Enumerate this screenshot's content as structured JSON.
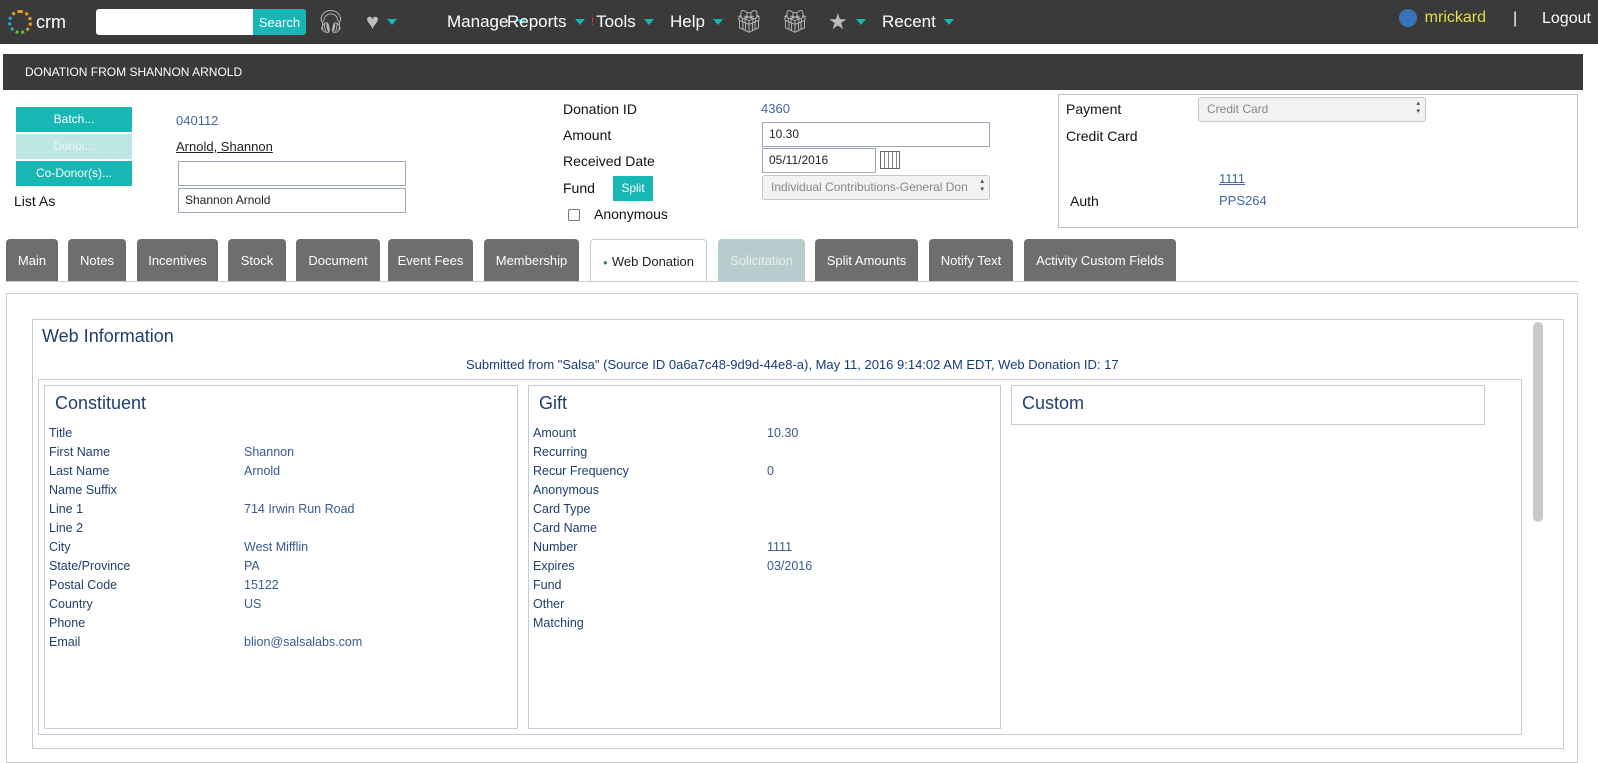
{
  "app": {
    "logo_text": "crm"
  },
  "nav": {
    "search_placeholder": "",
    "search_label": "Search",
    "manage": "Manage",
    "reports": "Reports",
    "tools": "Tools",
    "help": "Help",
    "recent": "Recent",
    "username": "mrickard",
    "separator": "|",
    "logout": "Logout"
  },
  "page": {
    "title": "DONATION FROM SHANNON ARNOLD"
  },
  "form": {
    "batch_label": "Batch...",
    "batch_value": "040112",
    "donor_label": "Donor...",
    "donor_value": "Arnold, Shannon",
    "codonor_label": "Co-Donor(s)...",
    "codonor_value": "",
    "list_as_label": "List As",
    "list_as_value": "Shannon Arnold",
    "donation_id_label": "Donation ID",
    "donation_id_value": "4360",
    "amount_label": "Amount",
    "amount_value": "10.30",
    "received_label": "Received Date",
    "received_value": "05/11/2016",
    "fund_label": "Fund",
    "split_label": "Split",
    "fund_value": "Individual Contributions-General Don",
    "anonymous_label": "Anonymous",
    "payment_label": "Payment",
    "payment_value": "Credit Card",
    "credit_card_label": "Credit Card",
    "credit_card_value": "1111",
    "auth_label": "Auth",
    "auth_value": "PPS264"
  },
  "tabs": [
    {
      "label": "Main"
    },
    {
      "label": "Notes"
    },
    {
      "label": "Incentives"
    },
    {
      "label": "Stock"
    },
    {
      "label": "Document"
    },
    {
      "label": "Event Fees"
    },
    {
      "label": "Membership"
    },
    {
      "label": "Web Donation"
    },
    {
      "label": "Solicitation"
    },
    {
      "label": "Split Amounts"
    },
    {
      "label": "Notify Text"
    },
    {
      "label": "Activity Custom Fields"
    }
  ],
  "web": {
    "title": "Web Information",
    "submitted": "Submitted from \"Salsa\" (Source ID 0a6a7c48-9d9d-44e8-a), May 11, 2016 9:14:02 AM EDT, Web Donation ID: 17",
    "constituent_title": "Constituent",
    "constituent": [
      {
        "k": "Title",
        "v": ""
      },
      {
        "k": "First Name",
        "v": "Shannon"
      },
      {
        "k": "Last Name",
        "v": "Arnold"
      },
      {
        "k": "Name Suffix",
        "v": ""
      },
      {
        "k": "Line 1",
        "v": "714 Irwin Run Road"
      },
      {
        "k": "Line 2",
        "v": ""
      },
      {
        "k": "City",
        "v": "West Mifflin"
      },
      {
        "k": "State/Province",
        "v": "PA"
      },
      {
        "k": "Postal Code",
        "v": "15122"
      },
      {
        "k": "Country",
        "v": "US"
      },
      {
        "k": "Phone",
        "v": ""
      },
      {
        "k": "Email",
        "v": "blion@salsalabs.com"
      }
    ],
    "gift_title": "Gift",
    "gift": [
      {
        "k": "Amount",
        "v": "10.30"
      },
      {
        "k": "Recurring",
        "v": ""
      },
      {
        "k": "Recur Frequency",
        "v": "0"
      },
      {
        "k": "Anonymous",
        "v": ""
      },
      {
        "k": "Card Type",
        "v": ""
      },
      {
        "k": "Card Name",
        "v": ""
      },
      {
        "k": "Number",
        "v": "1111"
      },
      {
        "k": "Expires",
        "v": "03/2016"
      },
      {
        "k": "Fund",
        "v": ""
      },
      {
        "k": "Other",
        "v": ""
      },
      {
        "k": "Matching",
        "v": ""
      }
    ],
    "custom_title": "Custom"
  }
}
